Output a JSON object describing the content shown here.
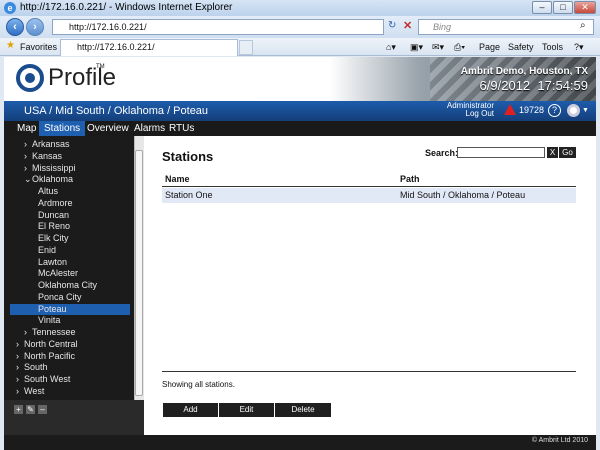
{
  "browser": {
    "title": "http://172.16.0.221/ - Windows Internet Explorer",
    "address": "http://172.16.0.221/",
    "search_placeholder": "Bing",
    "favorites": "Favorites",
    "tab_title": "http://172.16.0.221/",
    "menu": [
      "Page",
      "Safety",
      "Tools"
    ]
  },
  "app": {
    "name": "Profile",
    "tm": "TM",
    "site": "Ambrit Demo, Houston, TX",
    "date": "6/9/2012",
    "time": "17:54:59",
    "breadcrumb": "USA / Mid South / Oklahoma / Poteau",
    "user": "Administrator",
    "logout": "Log Out",
    "alarm_count": "19728",
    "footer": "© Ambrit Ltd 2010"
  },
  "nav": [
    "Map",
    "Stations",
    "Overview",
    "Alarms",
    "RTUs"
  ],
  "tree": [
    {
      "label": "Arkansas",
      "prefix": "›",
      "indent": 0
    },
    {
      "label": "Kansas",
      "prefix": "›",
      "indent": 0
    },
    {
      "label": "Mississippi",
      "prefix": "›",
      "indent": 0
    },
    {
      "label": "Oklahoma",
      "prefix": "⌄",
      "indent": 0
    },
    {
      "label": "Altus",
      "prefix": "",
      "indent": 1
    },
    {
      "label": "Ardmore",
      "prefix": "",
      "indent": 1
    },
    {
      "label": "Duncan",
      "prefix": "",
      "indent": 1
    },
    {
      "label": "El Reno",
      "prefix": "",
      "indent": 1
    },
    {
      "label": "Elk City",
      "prefix": "",
      "indent": 1
    },
    {
      "label": "Enid",
      "prefix": "",
      "indent": 1
    },
    {
      "label": "Lawton",
      "prefix": "",
      "indent": 1
    },
    {
      "label": "McAlester",
      "prefix": "",
      "indent": 1
    },
    {
      "label": "Oklahoma City",
      "prefix": "",
      "indent": 1
    },
    {
      "label": "Ponca City",
      "prefix": "",
      "indent": 1
    },
    {
      "label": "Poteau",
      "prefix": "",
      "indent": 1
    },
    {
      "label": "Vinita",
      "prefix": "",
      "indent": 1
    },
    {
      "label": "Tennessee",
      "prefix": "›",
      "indent": 0
    },
    {
      "label": "North Central",
      "prefix": "›",
      "indent": -1
    },
    {
      "label": "North Pacific",
      "prefix": "›",
      "indent": -1
    },
    {
      "label": "South",
      "prefix": "›",
      "indent": -1
    },
    {
      "label": "South West",
      "prefix": "›",
      "indent": -1
    },
    {
      "label": "West",
      "prefix": "›",
      "indent": -1
    }
  ],
  "main": {
    "title": "Stations",
    "search_label": "Search:",
    "search_value": "",
    "clear": "X",
    "go": "Go",
    "columns": [
      "Name",
      "Path"
    ],
    "rows": [
      [
        "Station One",
        "Mid South / Oklahoma / Poteau"
      ]
    ],
    "status": "Showing all stations.",
    "buttons": [
      "Add",
      "Edit",
      "Delete"
    ]
  },
  "colors": {
    "accent": "#1e5fb0",
    "alarm": "#e02020"
  }
}
